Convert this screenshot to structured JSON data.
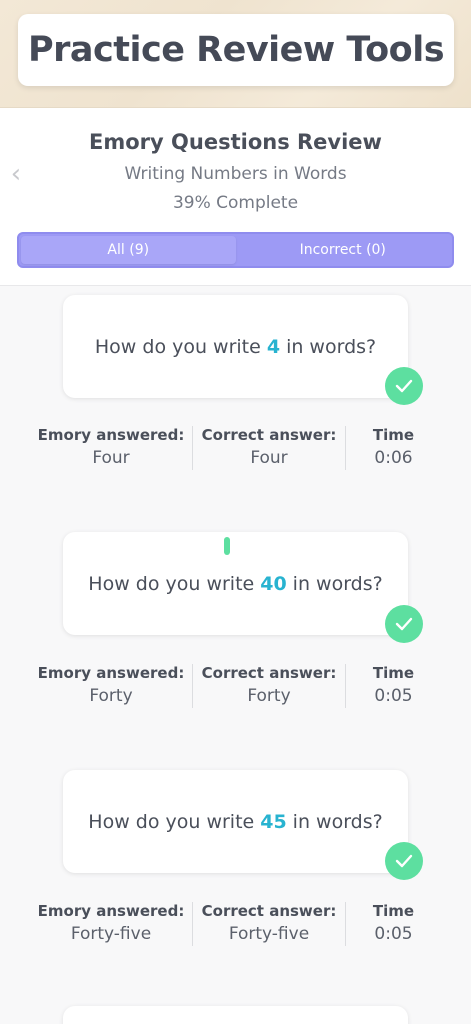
{
  "banner": {
    "title": "Practice Review Tools"
  },
  "header": {
    "title": "Emory Questions Review",
    "subtitle": "Writing Numbers in Words",
    "progress": "39% Complete"
  },
  "tabs": [
    {
      "label": "All (9)",
      "active": true
    },
    {
      "label": "Incorrect (0)",
      "active": false
    }
  ],
  "column_labels": {
    "answered": "Emory answered:",
    "correct": "Correct answer:",
    "time": "Time"
  },
  "questions": [
    {
      "prefix": "How do you write",
      "number": "4",
      "suffix": "in words?",
      "answered": "Four",
      "correct": "Four",
      "time": "0:06",
      "status": "correct"
    },
    {
      "prefix": "How do you write",
      "number": "40",
      "suffix": "in words?",
      "answered": "Forty",
      "correct": "Forty",
      "time": "0:05",
      "status": "correct"
    },
    {
      "prefix": "How do you write",
      "number": "45",
      "suffix": "in words?",
      "answered": "Forty-five",
      "correct": "Forty-five",
      "time": "0:05",
      "status": "correct"
    }
  ],
  "colors": {
    "accent": "#9d9af5",
    "number_highlight": "#28b3d0",
    "success": "#5ddfa0"
  },
  "icons": {
    "back": "chevron-left-icon",
    "status": "checkmark-icon"
  }
}
